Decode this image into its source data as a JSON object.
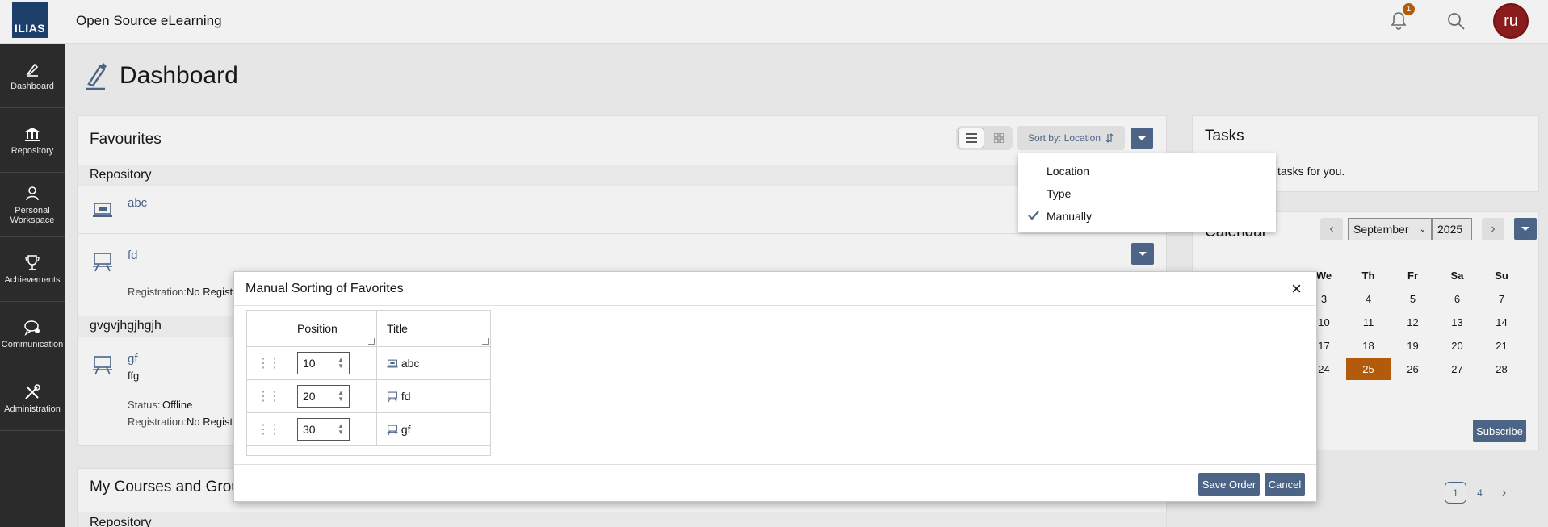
{
  "header": {
    "logo_text": "ILIAS",
    "site_title": "Open Source eLearning",
    "notification_count": "1",
    "avatar_initials": "ru"
  },
  "leftnav": {
    "items": [
      {
        "label": "Dashboard",
        "icon": "dashboard-icon"
      },
      {
        "label": "Repository",
        "icon": "repository-icon"
      },
      {
        "label": "Personal Workspace",
        "icon": "person-icon"
      },
      {
        "label": "Achievements",
        "icon": "trophy-icon"
      },
      {
        "label": "Communication",
        "icon": "chat-icon"
      },
      {
        "label": "Administration",
        "icon": "tools-icon"
      }
    ]
  },
  "main": {
    "page_title": "Dashboard",
    "favourites": {
      "title": "Favourites",
      "sort_label": "Sort by: Location",
      "sort_options": [
        "Location",
        "Type",
        "Manually"
      ],
      "selected_sort": "Manually",
      "group1_label": "Repository",
      "item1": {
        "title": "abc"
      },
      "item2": {
        "title": "fd",
        "registration_label": "Registration:",
        "registration_value": "No Registr"
      },
      "group2_label": "gvgvjhgjhgjh",
      "item3": {
        "title": "gf",
        "description": "ffg",
        "status_label": "Status:",
        "status_value": "Offline",
        "registration_label": "Registration:",
        "registration_value": "No Registr"
      }
    },
    "courses": {
      "title": "My Courses and Grou",
      "group_label": "Repository"
    }
  },
  "modal": {
    "title": "Manual Sorting of Favorites",
    "close_label": "×",
    "columns": [
      "Position",
      "Title"
    ],
    "rows": [
      {
        "position": "10",
        "title": "abc",
        "icon": "learning-module-icon"
      },
      {
        "position": "20",
        "title": "fd",
        "icon": "session-icon"
      },
      {
        "position": "30",
        "title": "gf",
        "icon": "session-icon"
      }
    ],
    "save_label": "Save Order",
    "cancel_label": "Cancel"
  },
  "tasks": {
    "title": "Tasks",
    "text": "tasks for you."
  },
  "calendar": {
    "title": "Calendar",
    "month": "September",
    "year": "2025",
    "weekdays": [
      "We",
      "Th",
      "Fr",
      "Sa",
      "Su"
    ],
    "weeks": [
      [
        "3",
        "4",
        "5",
        "6",
        "7"
      ],
      [
        "10",
        "11",
        "12",
        "13",
        "14"
      ],
      [
        "17",
        "18",
        "19",
        "20",
        "21"
      ],
      [
        "24",
        "25",
        "26",
        "27",
        "28"
      ]
    ],
    "today": "25",
    "subscribe_label": "Subscribe",
    "pagination": [
      "1",
      "4"
    ]
  },
  "colors": {
    "accent": "#4c6586",
    "today": "#b35a0b",
    "nav_bg": "#2b2b2b",
    "avatar": "#8a1c1c"
  }
}
